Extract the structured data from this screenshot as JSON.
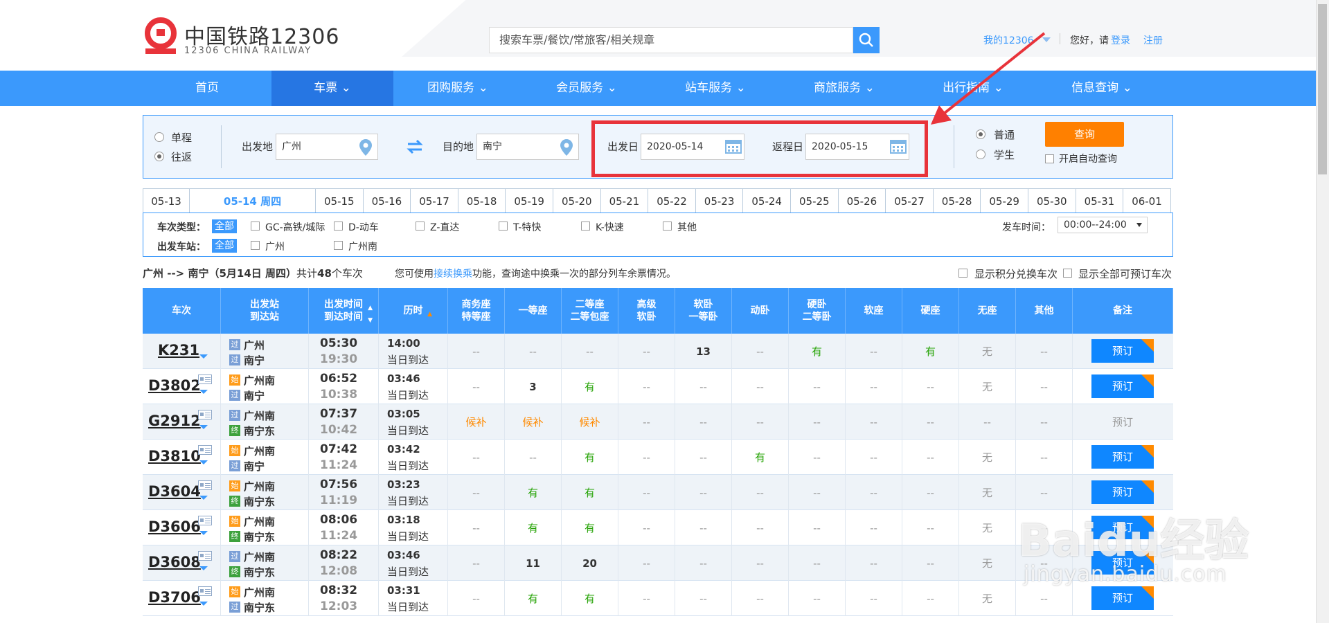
{
  "header": {
    "logo_cn": "中国铁路12306",
    "logo_en": "12306 CHINA RAILWAY",
    "search_placeholder": "搜索车票/餐饮/常旅客/相关规章",
    "my12306": "我的12306",
    "greeting": "您好，请",
    "login": "登录",
    "register": "注册"
  },
  "nav": [
    "首页",
    "车票",
    "团购服务",
    "会员服务",
    "站车服务",
    "商旅服务",
    "出行指南",
    "信息查询"
  ],
  "query": {
    "oneway": "单程",
    "roundtrip": "往返",
    "from_label": "出发地",
    "from_value": "广州",
    "to_label": "目的地",
    "to_value": "南宁",
    "depart_label": "出发日",
    "depart_value": "2020-05-14",
    "return_label": "返程日",
    "return_value": "2020-05-15",
    "normal": "普通",
    "student": "学生",
    "query_btn": "查询",
    "auto_query": "开启自动查询"
  },
  "dates": [
    "05-13",
    "05-14 周四",
    "05-15",
    "05-16",
    "05-17",
    "05-18",
    "05-19",
    "05-20",
    "05-21",
    "05-22",
    "05-23",
    "05-24",
    "05-25",
    "05-26",
    "05-27",
    "05-28",
    "05-29",
    "05-30",
    "05-31",
    "06-01"
  ],
  "filters": {
    "type_label": "车次类型：",
    "all": "全部",
    "types": [
      "GC-高铁/城际",
      "D-动车",
      "Z-直达",
      "T-特快",
      "K-快速",
      "其他"
    ],
    "station_label": "出发车站：",
    "stations": [
      "广州",
      "广州南"
    ],
    "time_label": "发车时间：",
    "time_value": "00:00--24:00"
  },
  "summary": {
    "route": "广州 --> 南宁（5月14日 周四）",
    "count_prefix": "共计",
    "count": "48",
    "count_suffix": "个车次",
    "hint_prefix": "您可使用",
    "hint_link": "接续换乘",
    "hint_suffix": "功能，查询途中换乘一次的部分列车余票情况。",
    "opt_points": "显示积分兑换车次",
    "opt_all": "显示全部可预订车次"
  },
  "columns": [
    [
      "车次",
      ""
    ],
    [
      "出发站",
      "到达站"
    ],
    [
      "出发时间",
      "到达时间"
    ],
    [
      "历时",
      ""
    ],
    [
      "商务座",
      "特等座"
    ],
    [
      "一等座",
      ""
    ],
    [
      "二等座",
      "二等包座"
    ],
    [
      "高级",
      "软卧"
    ],
    [
      "软卧",
      "一等卧"
    ],
    [
      "动卧",
      ""
    ],
    [
      "硬卧",
      "二等卧"
    ],
    [
      "软座",
      ""
    ],
    [
      "硬座",
      ""
    ],
    [
      "无座",
      ""
    ],
    [
      "其他",
      ""
    ],
    [
      "备注",
      ""
    ]
  ],
  "trains": [
    {
      "no": "K231",
      "icon": false,
      "from": "广州",
      "from_badge": "过",
      "to": "南宁",
      "to_badge": "过",
      "dep": "05:30",
      "arr": "19:30",
      "dur": "14:00",
      "day": "当日到达",
      "seats": [
        "--",
        "--",
        "--",
        "--",
        "13",
        "--",
        "有",
        "--",
        "有",
        "无",
        "--"
      ],
      "book": "预订",
      "bookable": true
    },
    {
      "no": "D3802",
      "icon": true,
      "from": "广州南",
      "from_badge": "始",
      "to": "南宁",
      "to_badge": "过",
      "dep": "06:52",
      "arr": "10:38",
      "dur": "03:46",
      "day": "当日到达",
      "seats": [
        "--",
        "3",
        "有",
        "--",
        "--",
        "--",
        "--",
        "--",
        "--",
        "无",
        "--"
      ],
      "book": "预订",
      "bookable": true
    },
    {
      "no": "G2912",
      "icon": true,
      "from": "广州南",
      "from_badge": "过",
      "to": "南宁东",
      "to_badge": "终",
      "dep": "07:37",
      "arr": "10:42",
      "dur": "03:05",
      "day": "当日到达",
      "seats": [
        "候补",
        "候补",
        "候补",
        "--",
        "--",
        "--",
        "--",
        "--",
        "--",
        "--",
        "--"
      ],
      "book": "预订",
      "bookable": false
    },
    {
      "no": "D3810",
      "icon": true,
      "from": "广州南",
      "from_badge": "始",
      "to": "南宁",
      "to_badge": "过",
      "dep": "07:42",
      "arr": "11:24",
      "dur": "03:42",
      "day": "当日到达",
      "seats": [
        "--",
        "--",
        "有",
        "--",
        "--",
        "有",
        "--",
        "--",
        "--",
        "无",
        "--"
      ],
      "book": "预订",
      "bookable": true
    },
    {
      "no": "D3604",
      "icon": true,
      "from": "广州南",
      "from_badge": "始",
      "to": "南宁东",
      "to_badge": "终",
      "dep": "07:56",
      "arr": "11:19",
      "dur": "03:23",
      "day": "当日到达",
      "seats": [
        "--",
        "有",
        "有",
        "--",
        "--",
        "--",
        "--",
        "--",
        "--",
        "无",
        "--"
      ],
      "book": "预订",
      "bookable": true
    },
    {
      "no": "D3606",
      "icon": true,
      "from": "广州南",
      "from_badge": "始",
      "to": "南宁东",
      "to_badge": "终",
      "dep": "08:06",
      "arr": "11:24",
      "dur": "03:18",
      "day": "当日到达",
      "seats": [
        "--",
        "有",
        "有",
        "--",
        "--",
        "--",
        "--",
        "--",
        "--",
        "无",
        "--"
      ],
      "book": "预订",
      "bookable": true
    },
    {
      "no": "D3608",
      "icon": true,
      "from": "广州南",
      "from_badge": "过",
      "to": "南宁东",
      "to_badge": "终",
      "dep": "08:22",
      "arr": "12:08",
      "dur": "03:46",
      "day": "当日到达",
      "seats": [
        "--",
        "11",
        "20",
        "--",
        "--",
        "--",
        "--",
        "--",
        "--",
        "无",
        "--"
      ],
      "book": "预订",
      "bookable": true
    },
    {
      "no": "D3706",
      "icon": true,
      "from": "广州南",
      "from_badge": "始",
      "to": "南宁东",
      "to_badge": "过",
      "dep": "08:32",
      "arr": "12:03",
      "dur": "03:31",
      "day": "当日到达",
      "seats": [
        "--",
        "有",
        "有",
        "--",
        "--",
        "--",
        "--",
        "--",
        "--",
        "无",
        "--"
      ],
      "book": "预订",
      "bookable": true
    }
  ],
  "watermark": {
    "brand": "Baidu经验",
    "url": "jingyan.baidu.com"
  },
  "colors": {
    "primary": "#3b99fc",
    "nav_active": "#2676e3",
    "accent_orange": "#ff8000",
    "available_green": "#26a306",
    "highlight_red": "#e8333a"
  }
}
